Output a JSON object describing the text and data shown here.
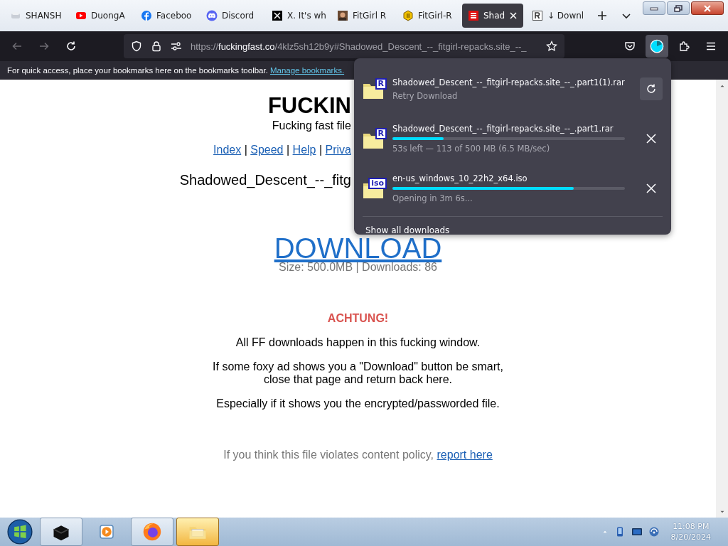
{
  "tabs": [
    {
      "title": "SHANSH",
      "selected": false
    },
    {
      "title": "DuongA",
      "selected": false
    },
    {
      "title": "Faceboo",
      "selected": false
    },
    {
      "title": "Discord",
      "selected": false
    },
    {
      "title": "X. It's wh",
      "selected": false
    },
    {
      "title": "FitGirl R",
      "selected": false
    },
    {
      "title": "FitGirl-R",
      "selected": false
    },
    {
      "title": "Shad",
      "selected": true
    },
    {
      "title": "↓ Downl",
      "selected": false
    }
  ],
  "address_bar": {
    "scheme": "https://",
    "domain": "fuckingfast.co",
    "path": "/4klz5sh12b9y#Shadowed_Descent_--_fitgirl-repacks.site_--_"
  },
  "bookmarks_bar": {
    "message": "For quick access, place your bookmarks here on the bookmarks toolbar.",
    "link": "Manage bookmarks."
  },
  "page": {
    "title": "FUCKIN",
    "subtitle": "Fucking fast file",
    "nav_links": [
      "Index",
      "Speed",
      "Help",
      "Priva"
    ],
    "nav_separators": [
      "|",
      "|",
      "|"
    ],
    "file_name": "Shadowed_Descent_--_fitg",
    "download_link": "DOWNLOAD",
    "file_info": "Size: 500.0MB | Downloads: 86",
    "warning_title": "ACHTUNG!",
    "paragraphs": [
      "All FF downloads happen in this fucking window.",
      "If some foxy ad shows you a \"Download\" button be smart,\nclose that page and return back here.",
      "Especially if it shows you the encrypted/passworded file."
    ],
    "policy_text": "If you think this file violates content policy,",
    "policy_link": "report here"
  },
  "downloads_panel": {
    "items": [
      {
        "kind": "failed",
        "badge": "R",
        "name": "Shadowed_Descent_--_fitgirl-repacks.site_--_.part1(1).rar",
        "status": "Retry Download"
      },
      {
        "kind": "downloading",
        "badge": "R",
        "name": "Shadowed_Descent_--_fitgirl-repacks.site_--_.part1.rar",
        "level": 0.22,
        "status": "53s left — 113 of 500 MB (6.5 MB/sec)"
      },
      {
        "kind": "downloading",
        "badge": "iso",
        "name": "en-us_windows_10_22h2_x64.iso",
        "level": 0.78,
        "status": "Opening in 3m 6s..."
      }
    ],
    "footer": "Show all downloads"
  },
  "taskbar": {
    "time": "11:08 PM",
    "date": "8/20/2024"
  }
}
